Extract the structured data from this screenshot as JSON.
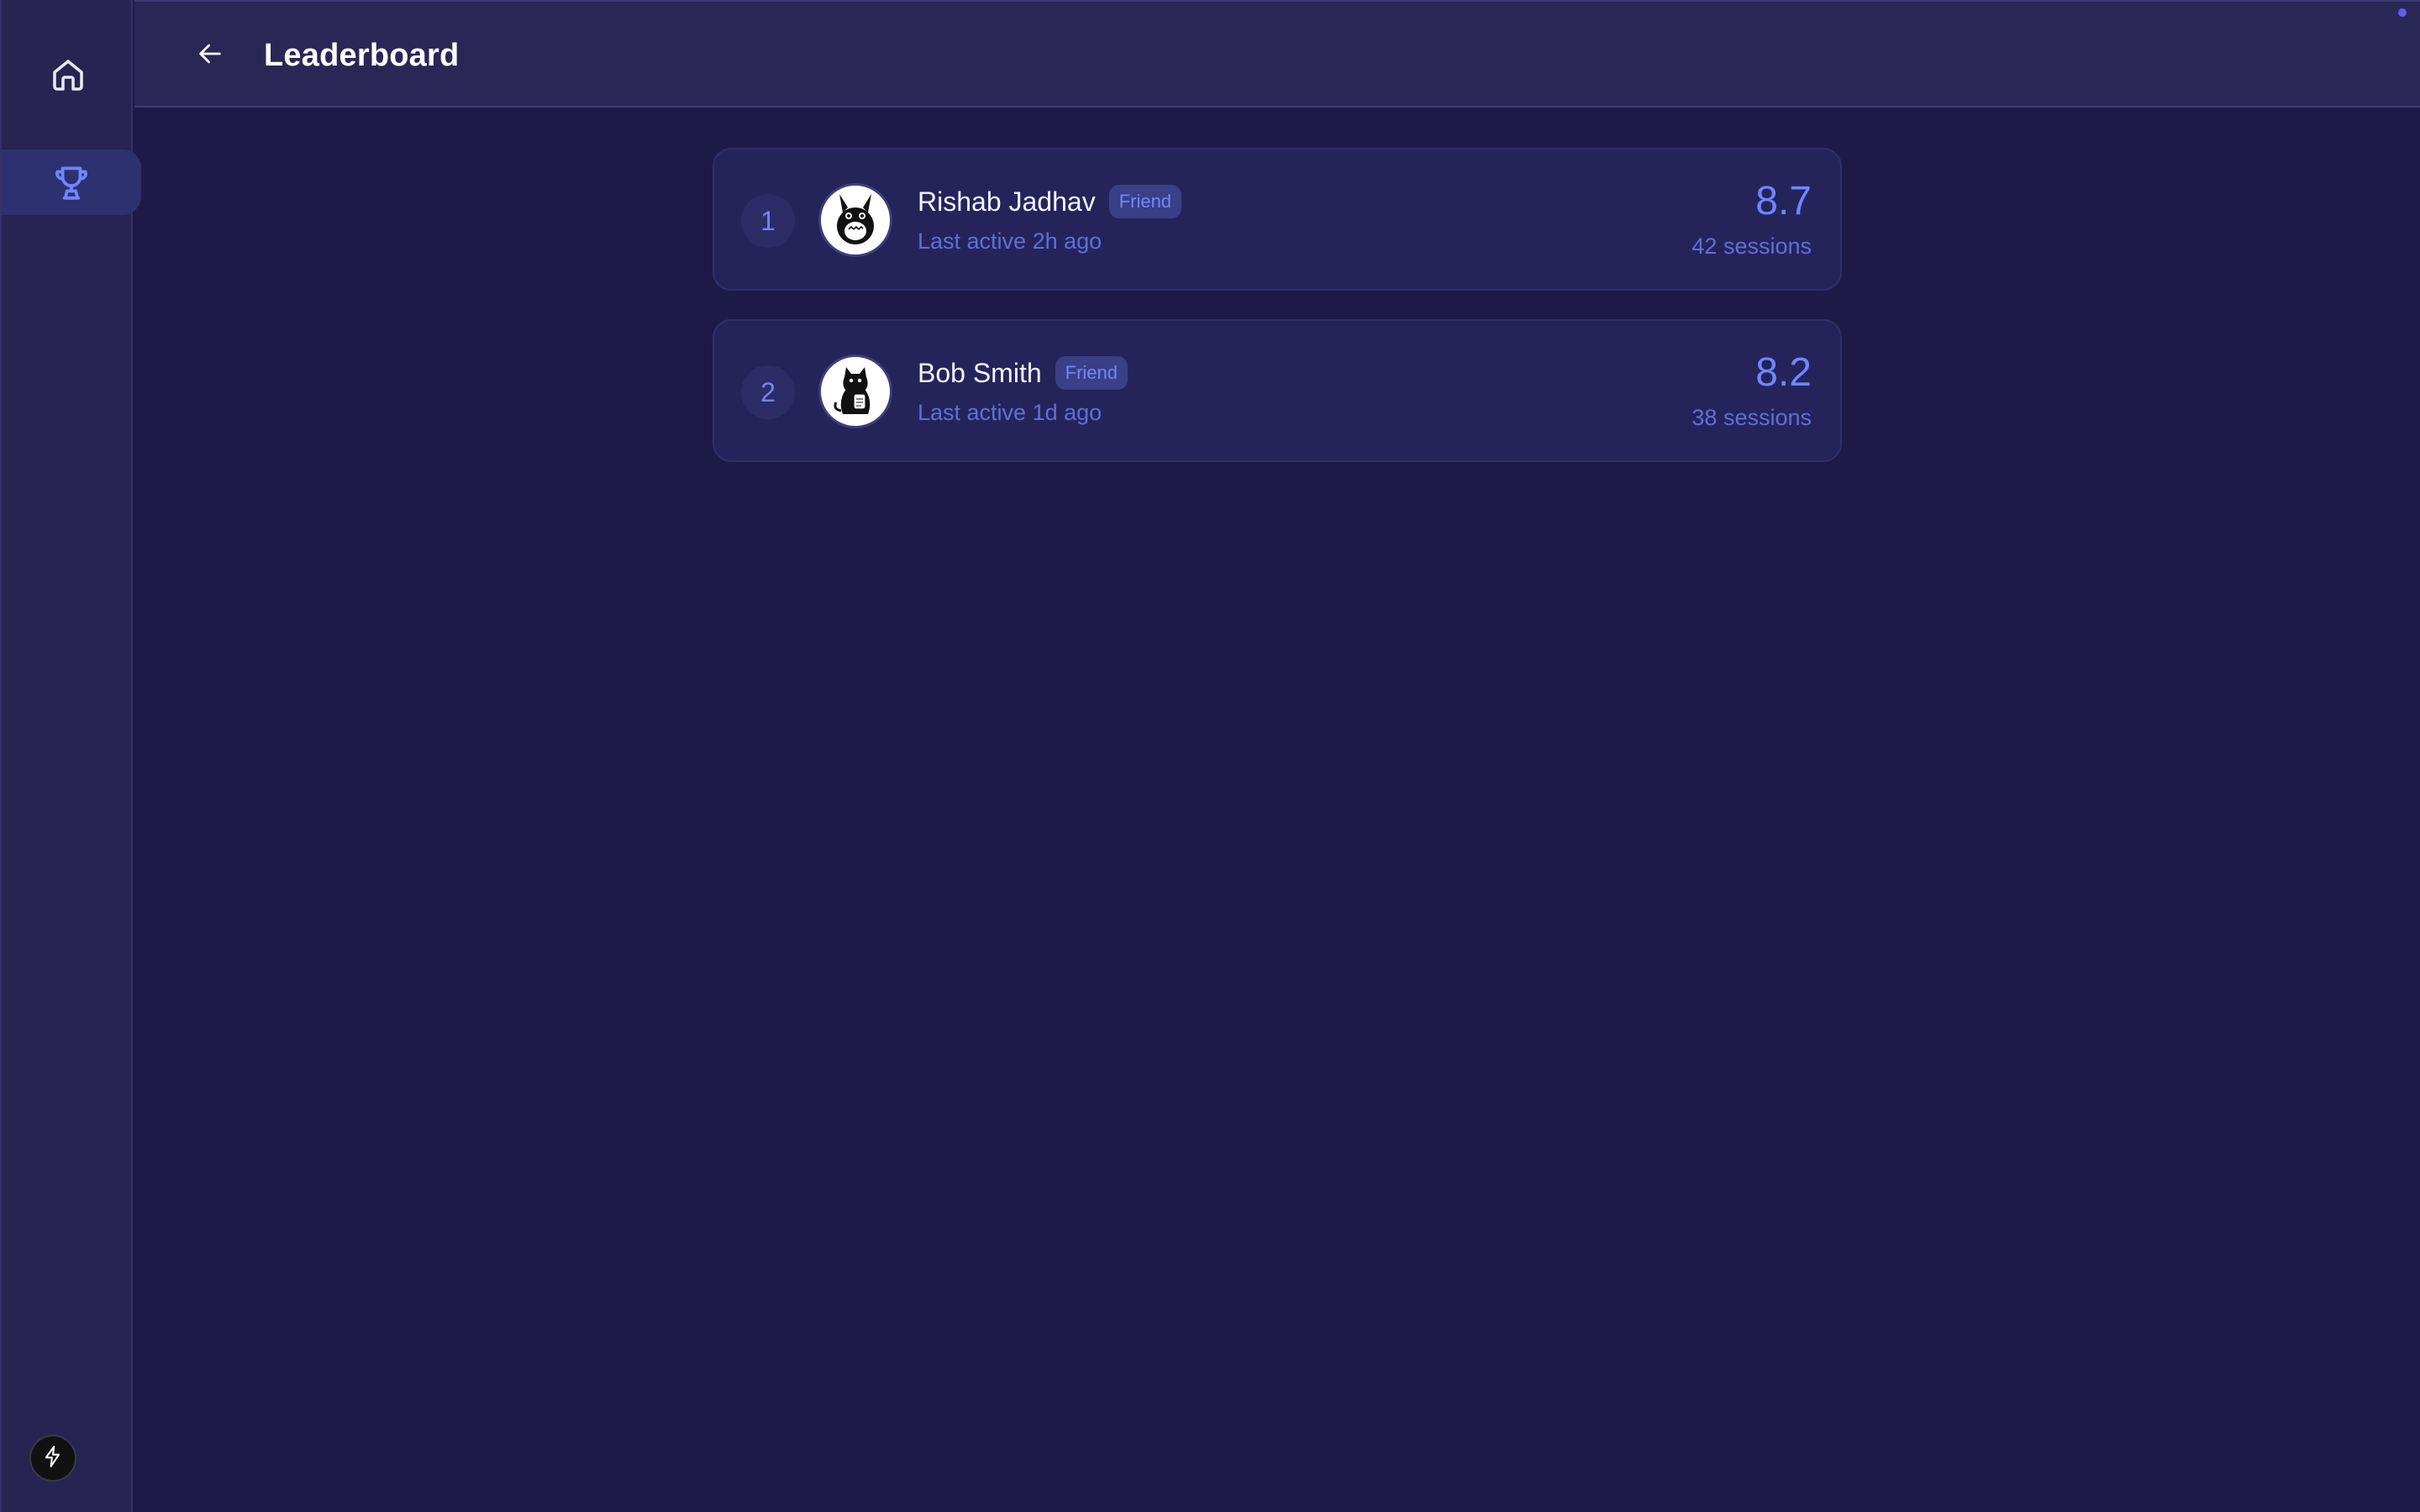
{
  "header": {
    "title": "Leaderboard",
    "back_icon": "arrow-left-icon"
  },
  "sidebar": {
    "items": [
      {
        "name": "home",
        "icon": "home-icon",
        "active": false
      },
      {
        "name": "leaderboard",
        "icon": "trophy-icon",
        "active": true
      }
    ],
    "footer_icon": "bolt-icon"
  },
  "leaderboard": {
    "rows": [
      {
        "rank": "1",
        "name": "Rishab Jadhav",
        "badge": "Friend",
        "last_active": "Last active 2h ago",
        "score": "8.7",
        "sessions": "42 sessions",
        "avatar_icon": "totoro-avatar-icon"
      },
      {
        "rank": "2",
        "name": "Bob Smith",
        "badge": "Friend",
        "last_active": "Last active 1d ago",
        "score": "8.2",
        "sessions": "38 sessions",
        "avatar_icon": "cat-avatar-icon"
      }
    ]
  },
  "colors": {
    "background": "#1e1a48",
    "sidebar": "#272451",
    "accent": "#6f86ff",
    "row": "#25245a"
  }
}
